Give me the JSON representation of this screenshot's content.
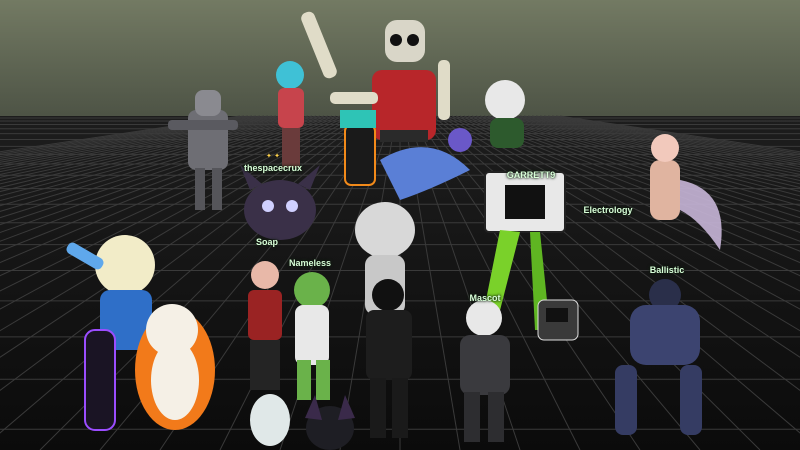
{
  "scene": {
    "type": "social-vr-group-photo",
    "colors": {
      "sky": "#6f7560",
      "horizon": "#4c5243",
      "floor": "#121212",
      "grid": "#3c3c3c",
      "nameplate_text": "#d8ffd8"
    }
  },
  "nameplates": [
    {
      "id": "thespacecrux",
      "text": "thespacecrux"
    },
    {
      "id": "garrett",
      "text": "GARRETT9"
    },
    {
      "id": "soap",
      "text": "Soap"
    },
    {
      "id": "electrology",
      "text": "Electrology"
    },
    {
      "id": "ballistic",
      "text": "Ballistic"
    },
    {
      "id": "mascot",
      "text": "Mascot"
    },
    {
      "id": "center_small",
      "text": "Nameless"
    }
  ],
  "icons": [
    {
      "name": "nameplate-badge-icons",
      "glyph": "✦ ✦"
    }
  ]
}
